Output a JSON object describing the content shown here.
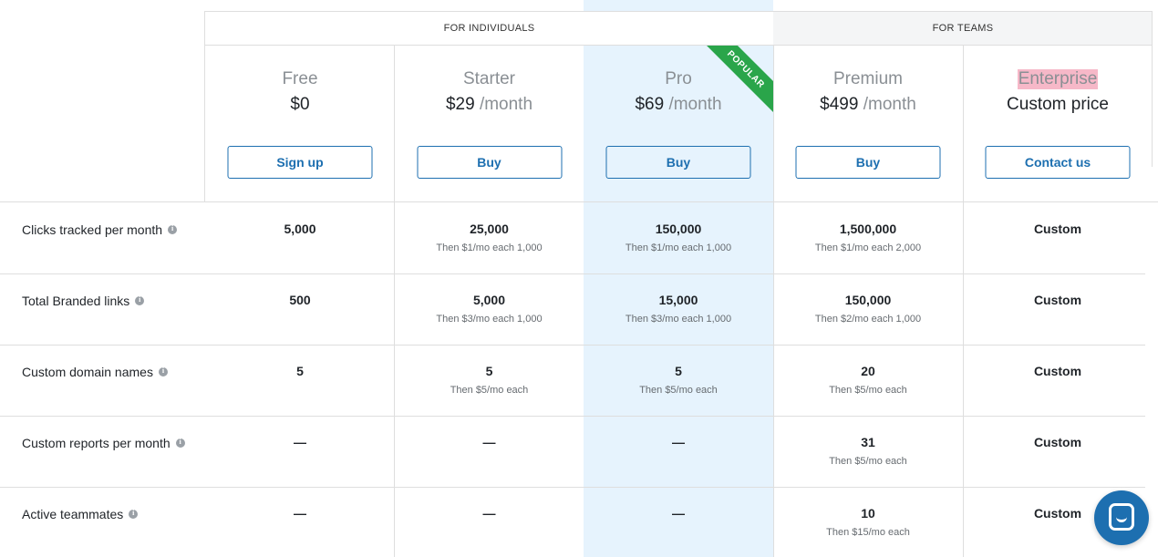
{
  "groups": {
    "individuals": "FOR INDIVIDUALS",
    "teams": "FOR TEAMS"
  },
  "ribbon": "POPULAR",
  "plans": {
    "free": {
      "name": "Free",
      "price": "$0",
      "per": "",
      "button": "Sign up"
    },
    "starter": {
      "name": "Starter",
      "price": "$29",
      "per": "/month",
      "button": "Buy"
    },
    "pro": {
      "name": "Pro",
      "price": "$69",
      "per": "/month",
      "button": "Buy"
    },
    "premium": {
      "name": "Premium",
      "price": "$499",
      "per": "/month",
      "button": "Buy"
    },
    "enterprise": {
      "name": "Enterprise",
      "price": "Custom price",
      "per": "",
      "button": "Contact us"
    }
  },
  "rows": [
    {
      "label": "Clicks tracked per month",
      "free": {
        "v": "5,000",
        "s": ""
      },
      "starter": {
        "v": "25,000",
        "s": "Then $1/mo each 1,000"
      },
      "pro": {
        "v": "150,000",
        "s": "Then $1/mo each 1,000"
      },
      "premium": {
        "v": "1,500,000",
        "s": "Then $1/mo each 2,000"
      },
      "enterprise": {
        "v": "Custom",
        "s": ""
      }
    },
    {
      "label": "Total Branded links",
      "free": {
        "v": "500",
        "s": ""
      },
      "starter": {
        "v": "5,000",
        "s": "Then $3/mo each 1,000"
      },
      "pro": {
        "v": "15,000",
        "s": "Then $3/mo each 1,000"
      },
      "premium": {
        "v": "150,000",
        "s": "Then $2/mo each 1,000"
      },
      "enterprise": {
        "v": "Custom",
        "s": ""
      }
    },
    {
      "label": "Custom domain names",
      "free": {
        "v": "5",
        "s": ""
      },
      "starter": {
        "v": "5",
        "s": "Then $5/mo each"
      },
      "pro": {
        "v": "5",
        "s": "Then $5/mo each"
      },
      "premium": {
        "v": "20",
        "s": "Then $5/mo each"
      },
      "enterprise": {
        "v": "Custom",
        "s": ""
      }
    },
    {
      "label": "Custom reports per month",
      "free": {
        "v": "—",
        "s": ""
      },
      "starter": {
        "v": "—",
        "s": ""
      },
      "pro": {
        "v": "—",
        "s": ""
      },
      "premium": {
        "v": "31",
        "s": "Then $5/mo each"
      },
      "enterprise": {
        "v": "Custom",
        "s": ""
      }
    },
    {
      "label": "Active teammates",
      "free": {
        "v": "—",
        "s": ""
      },
      "starter": {
        "v": "—",
        "s": ""
      },
      "pro": {
        "v": "—",
        "s": ""
      },
      "premium": {
        "v": "10",
        "s": "Then $15/mo each"
      },
      "enterprise": {
        "v": "Custom",
        "s": ""
      }
    }
  ],
  "icons": {
    "info": "info-icon",
    "chat": "chat-icon"
  },
  "colors": {
    "accent": "#1d6fb0",
    "pro_highlight": "#e6f3fd",
    "ribbon": "#2aa54a",
    "enterprise_highlight": "#f6b8c8"
  }
}
